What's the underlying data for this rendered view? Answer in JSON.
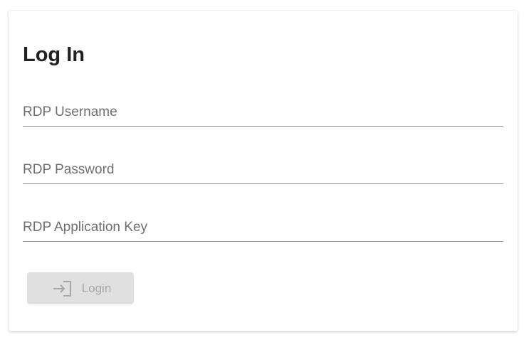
{
  "login_form": {
    "title": "Log In",
    "fields": {
      "username": {
        "label": "RDP Username",
        "value": ""
      },
      "password": {
        "label": "RDP Password",
        "value": ""
      },
      "app_key": {
        "label": "RDP Application Key",
        "value": ""
      }
    },
    "login_button": {
      "label": "Login",
      "icon": "login-icon",
      "disabled": true
    }
  },
  "colors": {
    "title": "#212121",
    "field_label": "#6f6f6f",
    "field_underline": "#8a8a8a",
    "button_bg_disabled": "#e0e0e0",
    "button_text_disabled": "#a6a6a6"
  }
}
